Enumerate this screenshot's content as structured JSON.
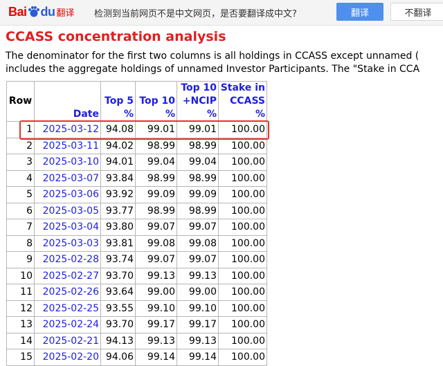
{
  "translate_bar": {
    "logo_bai": "Bai",
    "logo_du": "du",
    "logo_fanyi": "翻译",
    "message": "检测到当前网页不是中文网页，是否要翻译成中文?",
    "translate_button": "翻译",
    "no_translate_button": "不翻译"
  },
  "page": {
    "title": "CCASS concentration analysis",
    "desc_line1": "The denominator for the first two columns is all holdings in CCASS except unnamed (",
    "desc_line2": "includes the aggregate holdings of unnamed Investor Participants. The \"Stake in CCA"
  },
  "table": {
    "headers": {
      "row": "Row",
      "date": "Date",
      "top5_a": "Top 5",
      "top5_b": "%",
      "top10_a": "Top 10",
      "top10_b": "%",
      "ncip_a": "Top 10",
      "ncip_b": "+NCIP",
      "ncip_c": "%",
      "stake_a": "Stake in",
      "stake_b": "CCASS",
      "stake_c": "%"
    },
    "rows": [
      {
        "row": "1",
        "date": "2025-03-12",
        "top5": "94.08",
        "top10": "99.01",
        "ncip": "99.01",
        "stake": "100.00"
      },
      {
        "row": "2",
        "date": "2025-03-11",
        "top5": "94.02",
        "top10": "98.99",
        "ncip": "98.99",
        "stake": "100.00"
      },
      {
        "row": "3",
        "date": "2025-03-10",
        "top5": "94.01",
        "top10": "99.04",
        "ncip": "99.04",
        "stake": "100.00"
      },
      {
        "row": "4",
        "date": "2025-03-07",
        "top5": "93.84",
        "top10": "98.99",
        "ncip": "98.99",
        "stake": "100.00"
      },
      {
        "row": "5",
        "date": "2025-03-06",
        "top5": "93.92",
        "top10": "99.09",
        "ncip": "99.09",
        "stake": "100.00"
      },
      {
        "row": "6",
        "date": "2025-03-05",
        "top5": "93.77",
        "top10": "98.99",
        "ncip": "98.99",
        "stake": "100.00"
      },
      {
        "row": "7",
        "date": "2025-03-04",
        "top5": "93.80",
        "top10": "99.07",
        "ncip": "99.07",
        "stake": "100.00"
      },
      {
        "row": "8",
        "date": "2025-03-03",
        "top5": "93.81",
        "top10": "99.08",
        "ncip": "99.08",
        "stake": "100.00"
      },
      {
        "row": "9",
        "date": "2025-02-28",
        "top5": "93.74",
        "top10": "99.07",
        "ncip": "99.07",
        "stake": "100.00"
      },
      {
        "row": "10",
        "date": "2025-02-27",
        "top5": "93.70",
        "top10": "99.13",
        "ncip": "99.13",
        "stake": "100.00"
      },
      {
        "row": "11",
        "date": "2025-02-26",
        "top5": "93.64",
        "top10": "99.00",
        "ncip": "99.00",
        "stake": "100.00"
      },
      {
        "row": "12",
        "date": "2025-02-25",
        "top5": "93.55",
        "top10": "99.10",
        "ncip": "99.10",
        "stake": "100.00"
      },
      {
        "row": "13",
        "date": "2025-02-24",
        "top5": "93.70",
        "top10": "99.17",
        "ncip": "99.17",
        "stake": "100.00"
      },
      {
        "row": "14",
        "date": "2025-02-21",
        "top5": "94.13",
        "top10": "99.13",
        "ncip": "99.13",
        "stake": "100.00"
      },
      {
        "row": "15",
        "date": "2025-02-20",
        "top5": "94.06",
        "top10": "99.14",
        "ncip": "99.14",
        "stake": "100.00"
      }
    ]
  },
  "colors": {
    "title": "#e11f1f",
    "link": "#1e1ee0",
    "highlight_box": "#e8312a",
    "translate_button": "#4e8ff0"
  },
  "icons": {
    "baidu_paw": "baidu-paw-icon"
  }
}
